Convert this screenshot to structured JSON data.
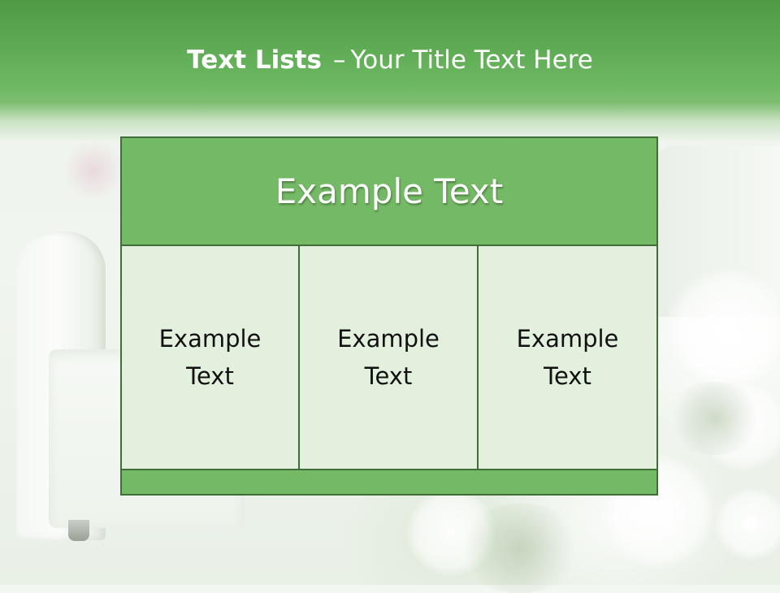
{
  "slide": {
    "title_bold": "Text Lists",
    "title_separator": "–",
    "title_rest": "Your Title Text Here"
  },
  "table": {
    "header": "Example Text",
    "cells": [
      "Example Text",
      "Example Text",
      "Example Text"
    ]
  },
  "colors": {
    "header_band": "#5da952",
    "table_header": "#74b965",
    "table_body": "#e3f0de",
    "table_border": "#3f6e36"
  }
}
